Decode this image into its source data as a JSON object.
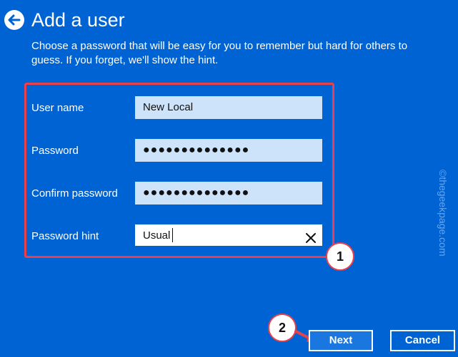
{
  "header": {
    "title": "Add a user",
    "subtitle": "Choose a password that will be easy for you to remember but hard for others to guess. If you forget, we'll show the hint."
  },
  "form": {
    "username": {
      "label": "User name",
      "value": "New Local"
    },
    "password": {
      "label": "Password",
      "value": "●●●●●●●●●●●●●●"
    },
    "confirm_password": {
      "label": "Confirm password",
      "value": "●●●●●●●●●●●●●●"
    },
    "password_hint": {
      "label": "Password hint",
      "value": "Usual"
    }
  },
  "annotations": {
    "step1": "1",
    "step2": "2"
  },
  "footer": {
    "next_label": "Next",
    "cancel_label": "Cancel"
  },
  "watermark": "©thegeekpage.com",
  "colors": {
    "background": "#0063d3",
    "field_fill": "#cde3f9",
    "highlight": "#e9414c"
  },
  "icons": {
    "back": "back-arrow-icon",
    "clear": "close-icon"
  }
}
